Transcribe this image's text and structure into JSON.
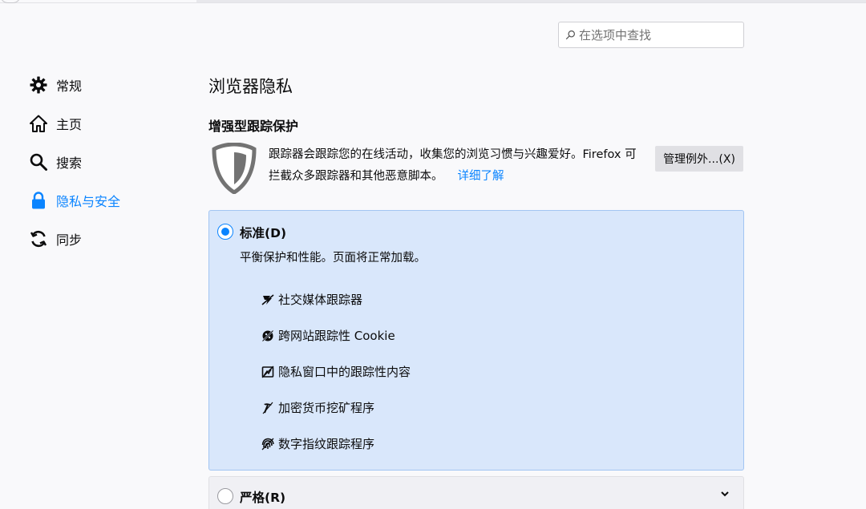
{
  "search": {
    "placeholder": "在选项中查找"
  },
  "sidebar": {
    "items": [
      {
        "label": "常规",
        "icon": "gear-icon"
      },
      {
        "label": "主页",
        "icon": "home-icon"
      },
      {
        "label": "搜索",
        "icon": "search-icon"
      },
      {
        "label": "隐私与安全",
        "icon": "lock-icon",
        "active": true
      },
      {
        "label": "同步",
        "icon": "sync-icon"
      }
    ]
  },
  "main": {
    "page_title": "浏览器隐私",
    "section_title": "增强型跟踪保护",
    "description": "跟踪器会跟踪您的在线活动，收集您的浏览习惯与兴趣爱好。Firefox 可拦截众多跟踪器和其他恶意脚本。",
    "learn_more": "详细了解",
    "manage_exceptions_button": "管理例外...(X)",
    "options": {
      "standard": {
        "label": "标准(D)",
        "description": "平衡保护和性能。页面将正常加载。",
        "selected": true,
        "blocked": [
          {
            "label": "社交媒体跟踪器",
            "icon": "social-tracker-icon"
          },
          {
            "label": "跨网站跟踪性 Cookie",
            "icon": "cookie-icon"
          },
          {
            "label": "隐私窗口中的跟踪性内容",
            "icon": "tracking-content-icon"
          },
          {
            "label": "加密货币挖矿程序",
            "icon": "cryptominer-icon"
          },
          {
            "label": "数字指纹跟踪程序",
            "icon": "fingerprinter-icon"
          }
        ]
      },
      "strict": {
        "label": "严格(R)",
        "selected": false
      }
    }
  },
  "colors": {
    "accent": "#0a84ff",
    "selected_bg": "#d9e7fb",
    "selected_border": "#a2c5f2"
  }
}
